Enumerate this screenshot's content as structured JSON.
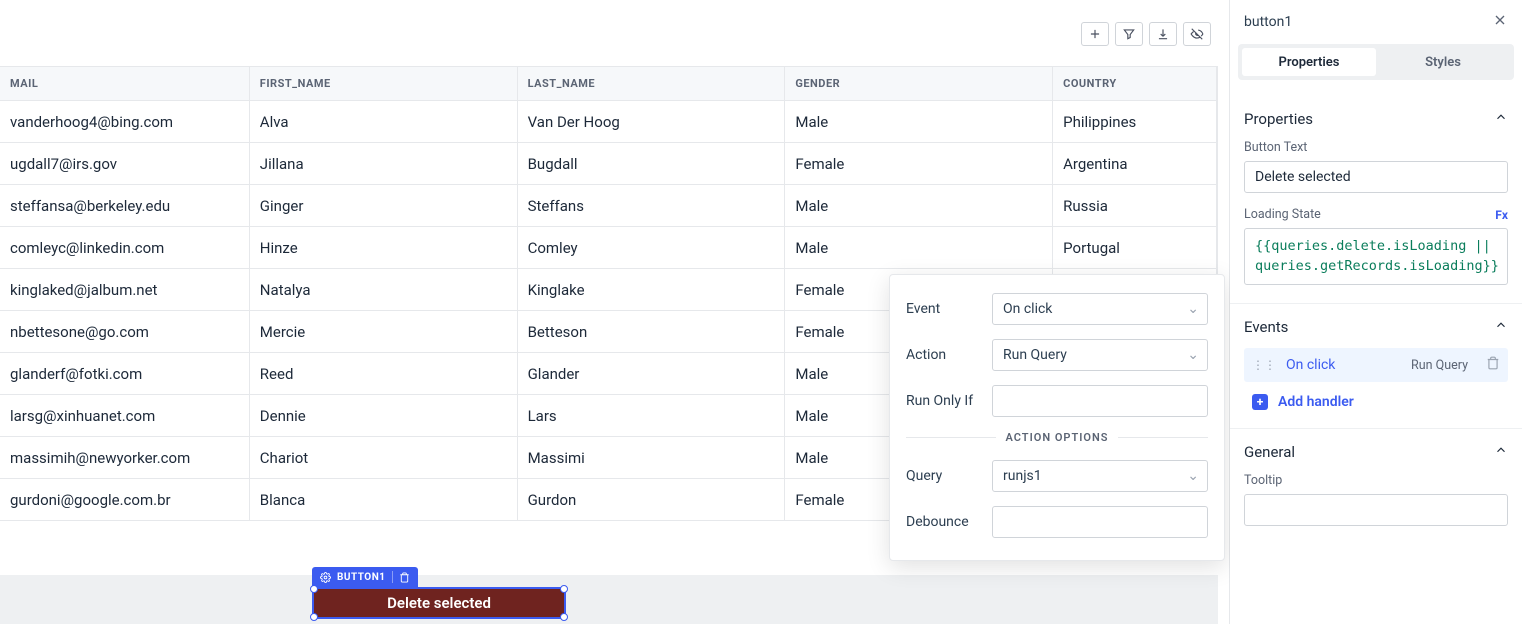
{
  "table": {
    "columns": [
      "MAIL",
      "FIRST_NAME",
      "LAST_NAME",
      "GENDER",
      "COUNTRY"
    ],
    "rows": [
      {
        "email": "vanderhoog4@bing.com",
        "first": "Alva",
        "last": "Van Der Hoog",
        "gender": "Male",
        "country": "Philippines"
      },
      {
        "email": "ugdall7@irs.gov",
        "first": "Jillana",
        "last": "Bugdall",
        "gender": "Female",
        "country": "Argentina"
      },
      {
        "email": "steffansa@berkeley.edu",
        "first": "Ginger",
        "last": "Steffans",
        "gender": "Male",
        "country": "Russia"
      },
      {
        "email": "comleyc@linkedin.com",
        "first": "Hinze",
        "last": "Comley",
        "gender": "Male",
        "country": "Portugal"
      },
      {
        "email": "kinglaked@jalbum.net",
        "first": "Natalya",
        "last": "Kinglake",
        "gender": "Female",
        "country": ""
      },
      {
        "email": "nbettesone@go.com",
        "first": "Mercie",
        "last": "Betteson",
        "gender": "Female",
        "country": ""
      },
      {
        "email": "glanderf@fotki.com",
        "first": "Reed",
        "last": "Glander",
        "gender": "Male",
        "country": ""
      },
      {
        "email": "larsg@xinhuanet.com",
        "first": "Dennie",
        "last": "Lars",
        "gender": "Male",
        "country": ""
      },
      {
        "email": "massimih@newyorker.com",
        "first": "Chariot",
        "last": "Massimi",
        "gender": "Male",
        "country": ""
      },
      {
        "email": "gurdoni@google.com.br",
        "first": "Blanca",
        "last": "Gurdon",
        "gender": "Female",
        "country": ""
      }
    ]
  },
  "widget": {
    "name": "BUTTON1",
    "label": "Delete selected"
  },
  "popover": {
    "event_label": "Event",
    "event_value": "On click",
    "action_label": "Action",
    "action_value": "Run Query",
    "run_only_if_label": "Run Only If",
    "run_only_if_value": "",
    "section_title": "ACTION OPTIONS",
    "query_label": "Query",
    "query_value": "runjs1",
    "debounce_label": "Debounce",
    "debounce_value": ""
  },
  "inspector": {
    "title": "button1",
    "tabs": {
      "properties": "Properties",
      "styles": "Styles"
    },
    "properties_section": {
      "title": "Properties",
      "button_text_label": "Button Text",
      "button_text_value": "Delete selected",
      "loading_state_label": "Loading State",
      "fx_label": "Fx",
      "loading_state_expr": "{{queries.delete.isLoading || queries.getRecords.isLoading}}"
    },
    "events_section": {
      "title": "Events",
      "items": [
        {
          "event": "On click",
          "action": "Run Query"
        }
      ],
      "add_handler": "Add handler"
    },
    "general_section": {
      "title": "General",
      "tooltip_label": "Tooltip",
      "tooltip_value": ""
    }
  }
}
